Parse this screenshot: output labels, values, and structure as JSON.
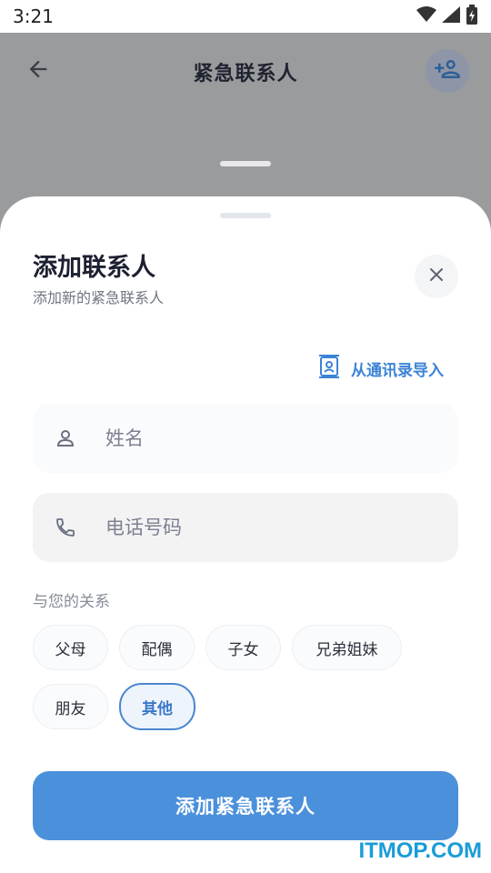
{
  "status_bar": {
    "time": "3:21"
  },
  "app_bar": {
    "title": "紧急联系人"
  },
  "sheet": {
    "title": "添加联系人",
    "subtitle": "添加新的紧急联系人",
    "import_label": "从通讯录导入",
    "name_placeholder": "姓名",
    "phone_placeholder": "电话号码",
    "relationship_label": "与您的关系",
    "relationships": [
      "父母",
      "配偶",
      "子女",
      "兄弟姐妹",
      "朋友",
      "其他"
    ],
    "selected_relationship": "其他",
    "submit_label": "添加紧急联系人"
  },
  "watermark": "ITMOP.COM",
  "colors": {
    "accent": "#4b90db",
    "link": "#3b83d6",
    "overlay": "#9a9b9d"
  }
}
